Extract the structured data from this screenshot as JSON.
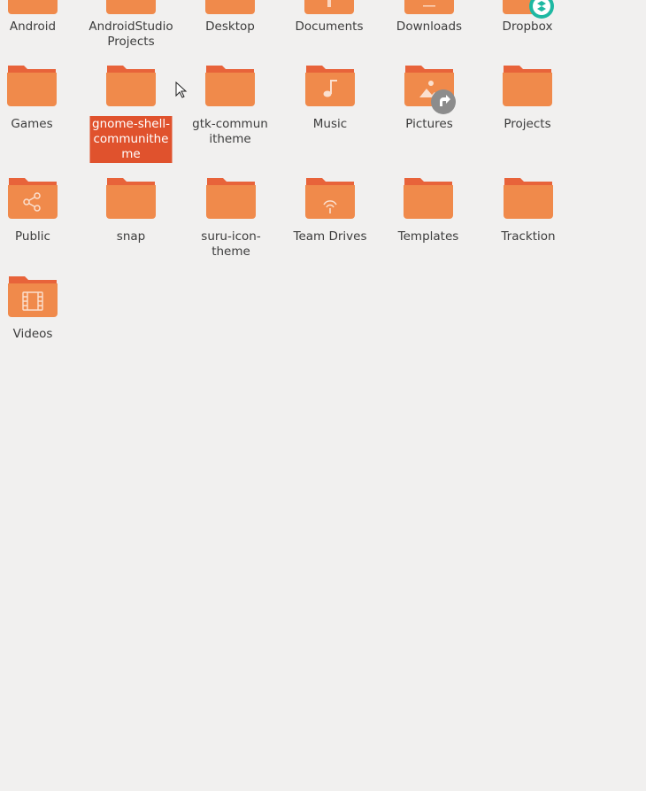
{
  "folders": {
    "row0": [
      "Android",
      "AndroidStudioProjects",
      "Desktop",
      "Documents",
      "Downloads",
      "Dropbox"
    ],
    "row1": [
      "Games",
      "gnome-shell-communitheme",
      "gtk-communitheme",
      "Music",
      "Pictures",
      "Projects"
    ],
    "row2": [
      "Public",
      "snap",
      "suru-icon-theme",
      "Team Drives",
      "Templates",
      "Tracktion"
    ],
    "row3": [
      "Videos"
    ]
  },
  "labels": {
    "android": "Android",
    "androidstudio": "AndroidStudioProjects",
    "desktop": "Desktop",
    "documents": "Documents",
    "downloads": "Downloads",
    "dropbox": "Dropbox",
    "games": "Games",
    "gnome_shell": "gnome-shell-communitheme",
    "gtk": "gtk-communitheme",
    "music": "Music",
    "pictures": "Pictures",
    "projects": "Projects",
    "public": "Public",
    "snap": "snap",
    "suru": "suru-icon-theme",
    "team_drives": "Team Drives",
    "templates": "Templates",
    "tracktion": "Tracktion",
    "videos": "Videos"
  },
  "selected_folder": "gnome-shell-communitheme",
  "colors": {
    "folder_body": "#f08a4b",
    "folder_tab": "#e8633a",
    "selection": "#e0522d",
    "background": "#f1f0ef",
    "dropbox_badge": "#1eb8a2",
    "emblem": "#8c8c8c"
  },
  "icons": {
    "documents": "document-emblem",
    "downloads": "download-emblem",
    "dropbox": "dropbox-badge",
    "music": "music-note",
    "pictures": "image-emblem-with-symlink",
    "public": "share-emblem",
    "team_drives": "wireless-emblem",
    "videos": "film-emblem"
  }
}
